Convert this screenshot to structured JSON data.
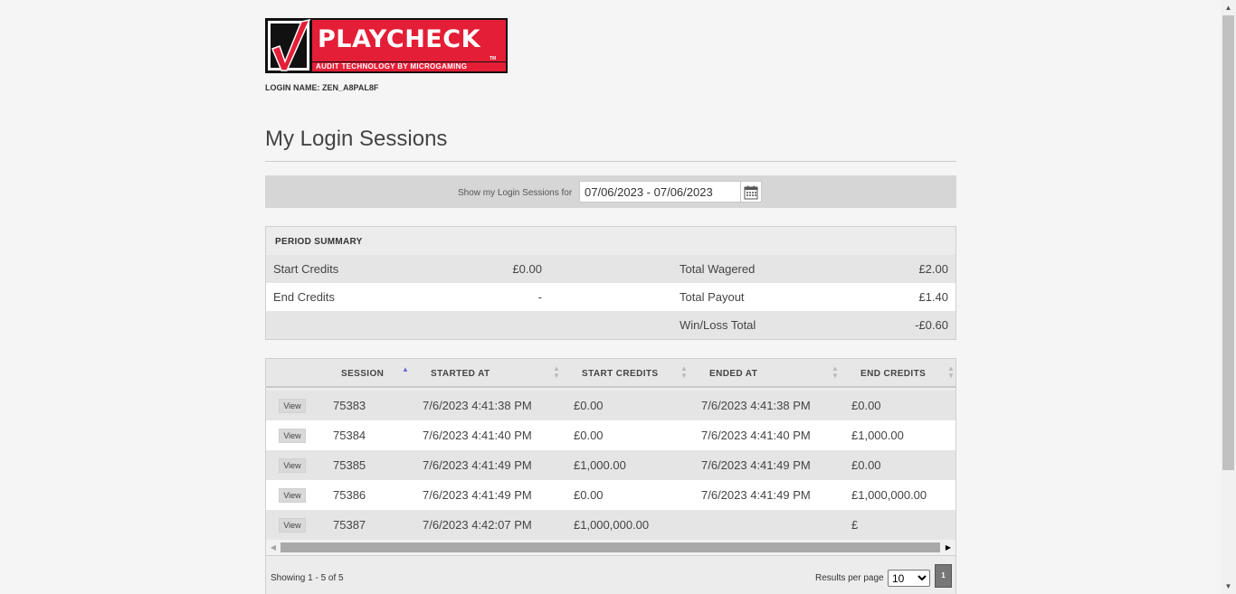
{
  "brand": {
    "name": "PLAYCHECK",
    "trademark": "TM",
    "tagline": "AUDIT TECHNOLOGY BY MICROGAMING",
    "accent_color": "#e41e36"
  },
  "login_name": "LOGIN NAME: ZEN_A8PAL8F",
  "page_title": "My Login Sessions",
  "filter": {
    "label": "Show my Login Sessions for",
    "date_range": "07/06/2023 - 07/06/2023",
    "calendar_icon": "calendar-icon"
  },
  "summary": {
    "heading": "PERIOD SUMMARY",
    "rows": [
      {
        "label_left": "Start Credits",
        "value_left": "£0.00",
        "label_right": "Total Wagered",
        "value_right": "£2.00"
      },
      {
        "label_left": "End Credits",
        "value_left": "-",
        "label_right": "Total Payout",
        "value_right": "£1.40"
      },
      {
        "label_left": "",
        "value_left": "",
        "label_right": "Win/Loss Total",
        "value_right": "-£0.60"
      }
    ]
  },
  "table": {
    "columns": [
      "SESSION",
      "STARTED AT",
      "START CREDITS",
      "ENDED AT",
      "END CREDITS"
    ],
    "sort_column": "SESSION",
    "view_label": "View",
    "rows": [
      {
        "session": "75383",
        "started_at": "7/6/2023 4:41:38 PM",
        "start_credits": "£0.00",
        "ended_at": "7/6/2023 4:41:38 PM",
        "end_credits": "£0.00"
      },
      {
        "session": "75384",
        "started_at": "7/6/2023 4:41:40 PM",
        "start_credits": "£0.00",
        "ended_at": "7/6/2023 4:41:40 PM",
        "end_credits": "£1,000.00"
      },
      {
        "session": "75385",
        "started_at": "7/6/2023 4:41:49 PM",
        "start_credits": "£1,000.00",
        "ended_at": "7/6/2023 4:41:49 PM",
        "end_credits": "£0.00"
      },
      {
        "session": "75386",
        "started_at": "7/6/2023 4:41:49 PM",
        "start_credits": "£0.00",
        "ended_at": "7/6/2023 4:41:49 PM",
        "end_credits": "£1,000,000.00"
      },
      {
        "session": "75387",
        "started_at": "7/6/2023 4:42:07 PM",
        "start_credits": "£1,000,000.00",
        "ended_at": "",
        "end_credits": "£"
      }
    ]
  },
  "footer": {
    "showing": "Showing 1 - 5 of 5",
    "results_per_page_label": "Results per page",
    "results_per_page_value": "10",
    "results_per_page_options": [
      "10"
    ],
    "current_page": "1"
  }
}
